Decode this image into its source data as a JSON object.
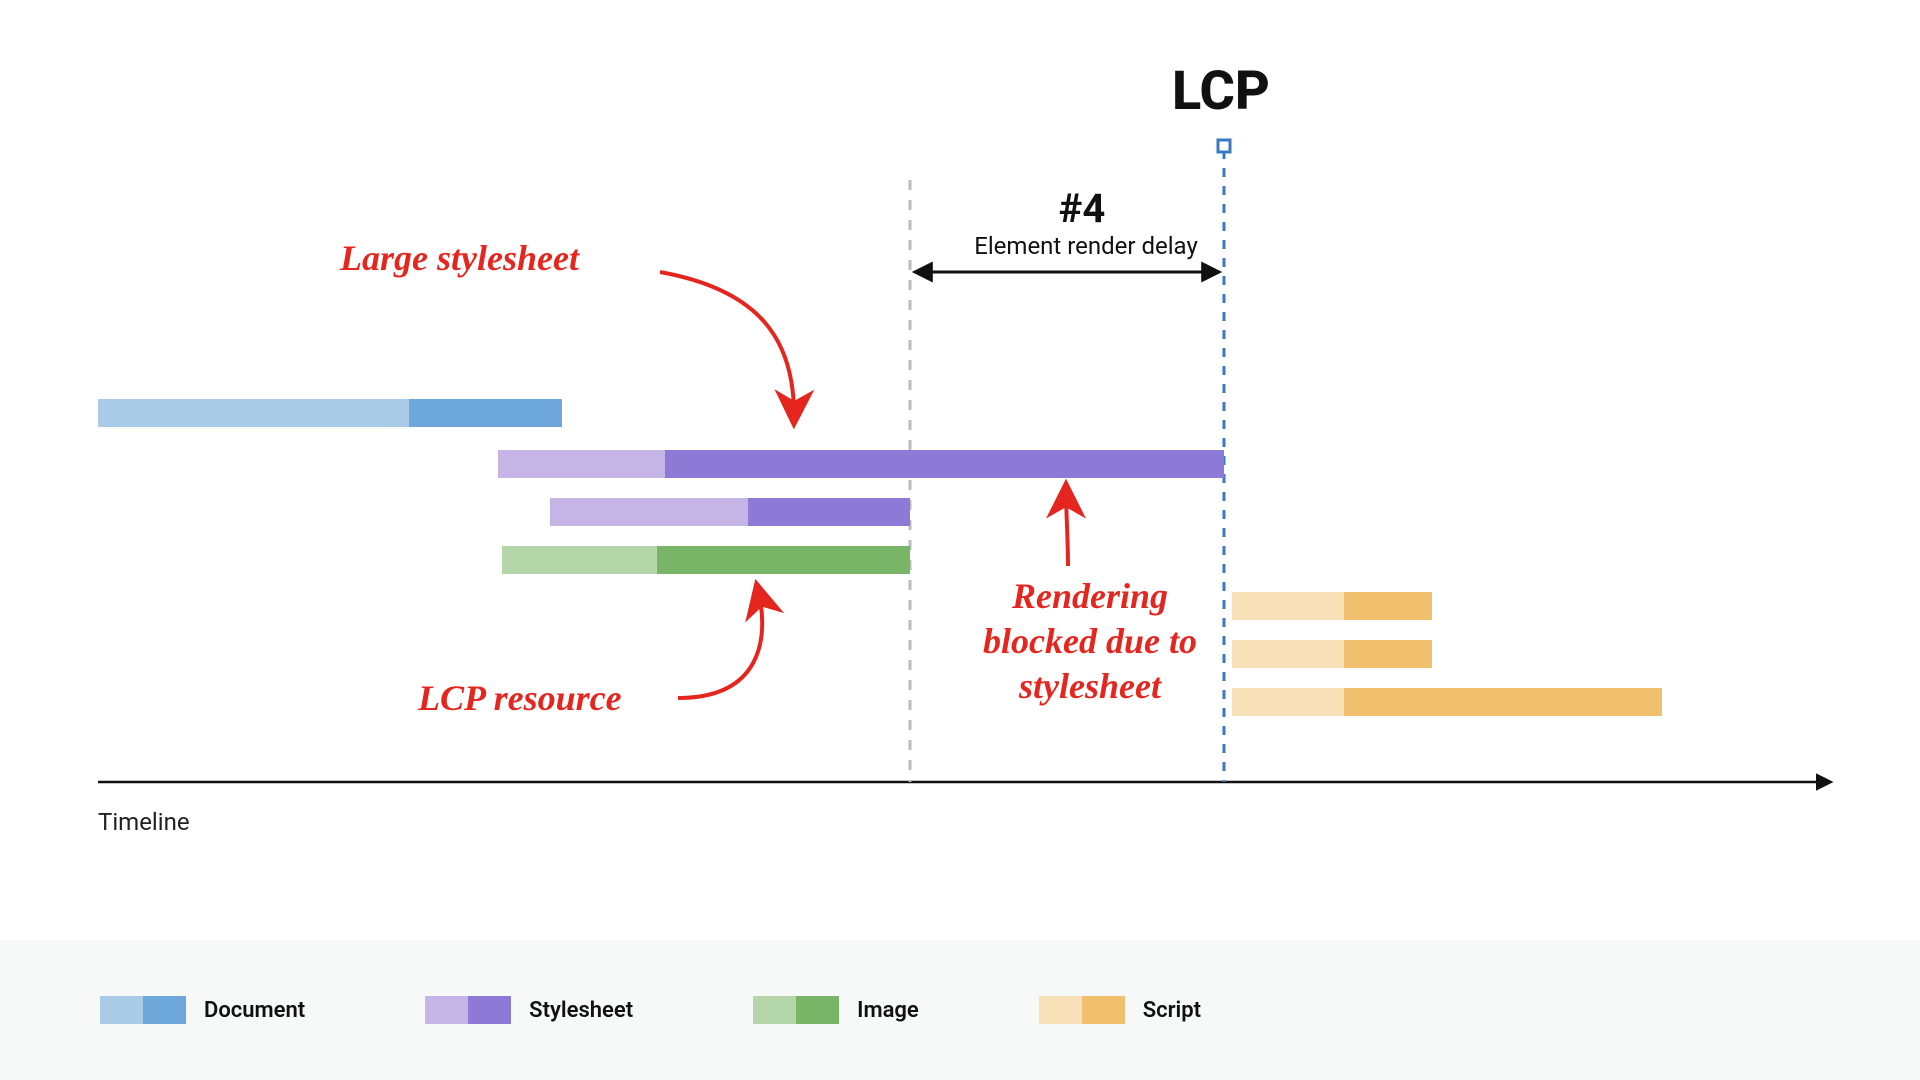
{
  "marker": {
    "label": "LCP"
  },
  "phase": {
    "num": "#4",
    "sub": "Element render delay"
  },
  "annotations": {
    "large_stylesheet": "Large stylesheet",
    "lcp_resource": "LCP resource",
    "render_blocked": "Rendering\nblocked due to\nstylesheet"
  },
  "axis": {
    "label": "Timeline"
  },
  "legend": {
    "document": "Document",
    "stylesheet": "Stylesheet",
    "image": "Image",
    "script": "Script"
  },
  "colors": {
    "doc_light": "#a9cbe8",
    "doc_dark": "#6ea7d9",
    "css_light": "#c5b4e6",
    "css_dark": "#8d79d6",
    "img_light": "#b5d6a9",
    "img_dark": "#79b566",
    "script_light": "#f8e1b9",
    "script_dark": "#f0c06e",
    "annot_red": "#e4261f",
    "marker_blue": "#3a7bbf",
    "gray_dash": "#bcbcbc"
  },
  "chart_data": {
    "type": "gantt",
    "title": "LCP waterfall with render-blocking stylesheet",
    "xlabel": "Timeline",
    "ylabel": "",
    "x_range": [
      0,
      100
    ],
    "markers": [
      {
        "name": "render-blocking end",
        "x": 50.3
      },
      {
        "name": "LCP",
        "x": 70.2
      }
    ],
    "phases": [
      {
        "name": "Element render delay",
        "num": 4,
        "start": 50.3,
        "end": 70.2
      }
    ],
    "annotations": [
      {
        "text": "Large stylesheet",
        "target": "stylesheet-large"
      },
      {
        "text": "LCP resource",
        "target": "image-lcp"
      },
      {
        "text": "Rendering blocked due to stylesheet",
        "region": [
          50.3,
          70.2
        ]
      }
    ],
    "legend": [
      "Document",
      "Stylesheet",
      "Image",
      "Script"
    ],
    "series": [
      {
        "name": "document",
        "type": "Document",
        "start": 0.3,
        "end": 27.5,
        "split": 18.7
      },
      {
        "name": "stylesheet-large",
        "type": "Stylesheet",
        "start": 23.6,
        "end": 70.2,
        "split": 34.0
      },
      {
        "name": "stylesheet-small",
        "type": "Stylesheet",
        "start": 26.7,
        "end": 48.4,
        "split": 38.3
      },
      {
        "name": "image-lcp",
        "type": "Image",
        "start": 24.4,
        "end": 50.3,
        "split": 34.0
      },
      {
        "name": "script-1",
        "type": "Script",
        "start": 70.6,
        "end": 82.5,
        "split": 77.4
      },
      {
        "name": "script-2",
        "type": "Script",
        "start": 70.6,
        "end": 82.5,
        "split": 77.4
      },
      {
        "name": "script-3",
        "type": "Script",
        "start": 70.6,
        "end": 96.3,
        "split": 77.4
      }
    ]
  }
}
